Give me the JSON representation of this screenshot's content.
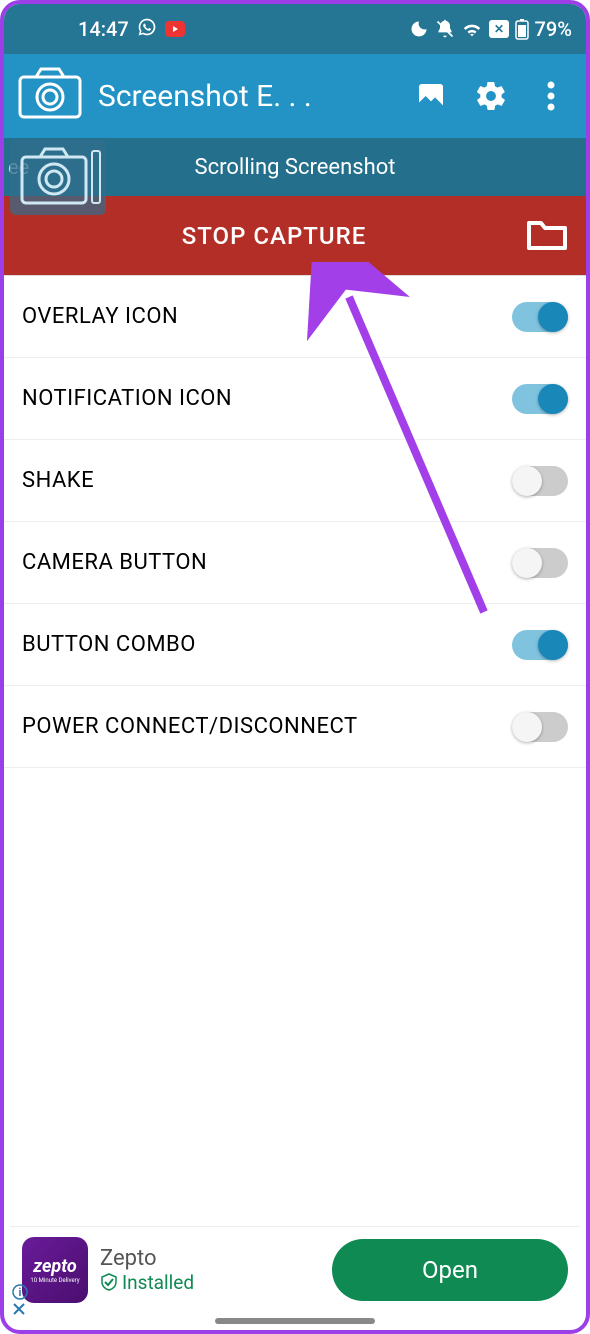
{
  "status": {
    "time": "14:47",
    "battery": "79%"
  },
  "app_bar": {
    "title": "Screenshot E. . ."
  },
  "sub_header": {
    "label": "Scrolling Screenshot",
    "left_trunc": "ee"
  },
  "stop_bar": {
    "label": "STOP CAPTURE"
  },
  "settings": [
    {
      "label": "OVERLAY ICON",
      "on": true
    },
    {
      "label": "NOTIFICATION ICON",
      "on": true
    },
    {
      "label": "SHAKE",
      "on": false
    },
    {
      "label": "CAMERA BUTTON",
      "on": false
    },
    {
      "label": "BUTTON COMBO",
      "on": true
    },
    {
      "label": "POWER CONNECT/DISCONNECT",
      "on": false
    }
  ],
  "ad": {
    "name": "Zepto",
    "logo_text": "zepto",
    "logo_sub": "10 Minute Delivery",
    "status": "Installed",
    "cta": "Open"
  }
}
